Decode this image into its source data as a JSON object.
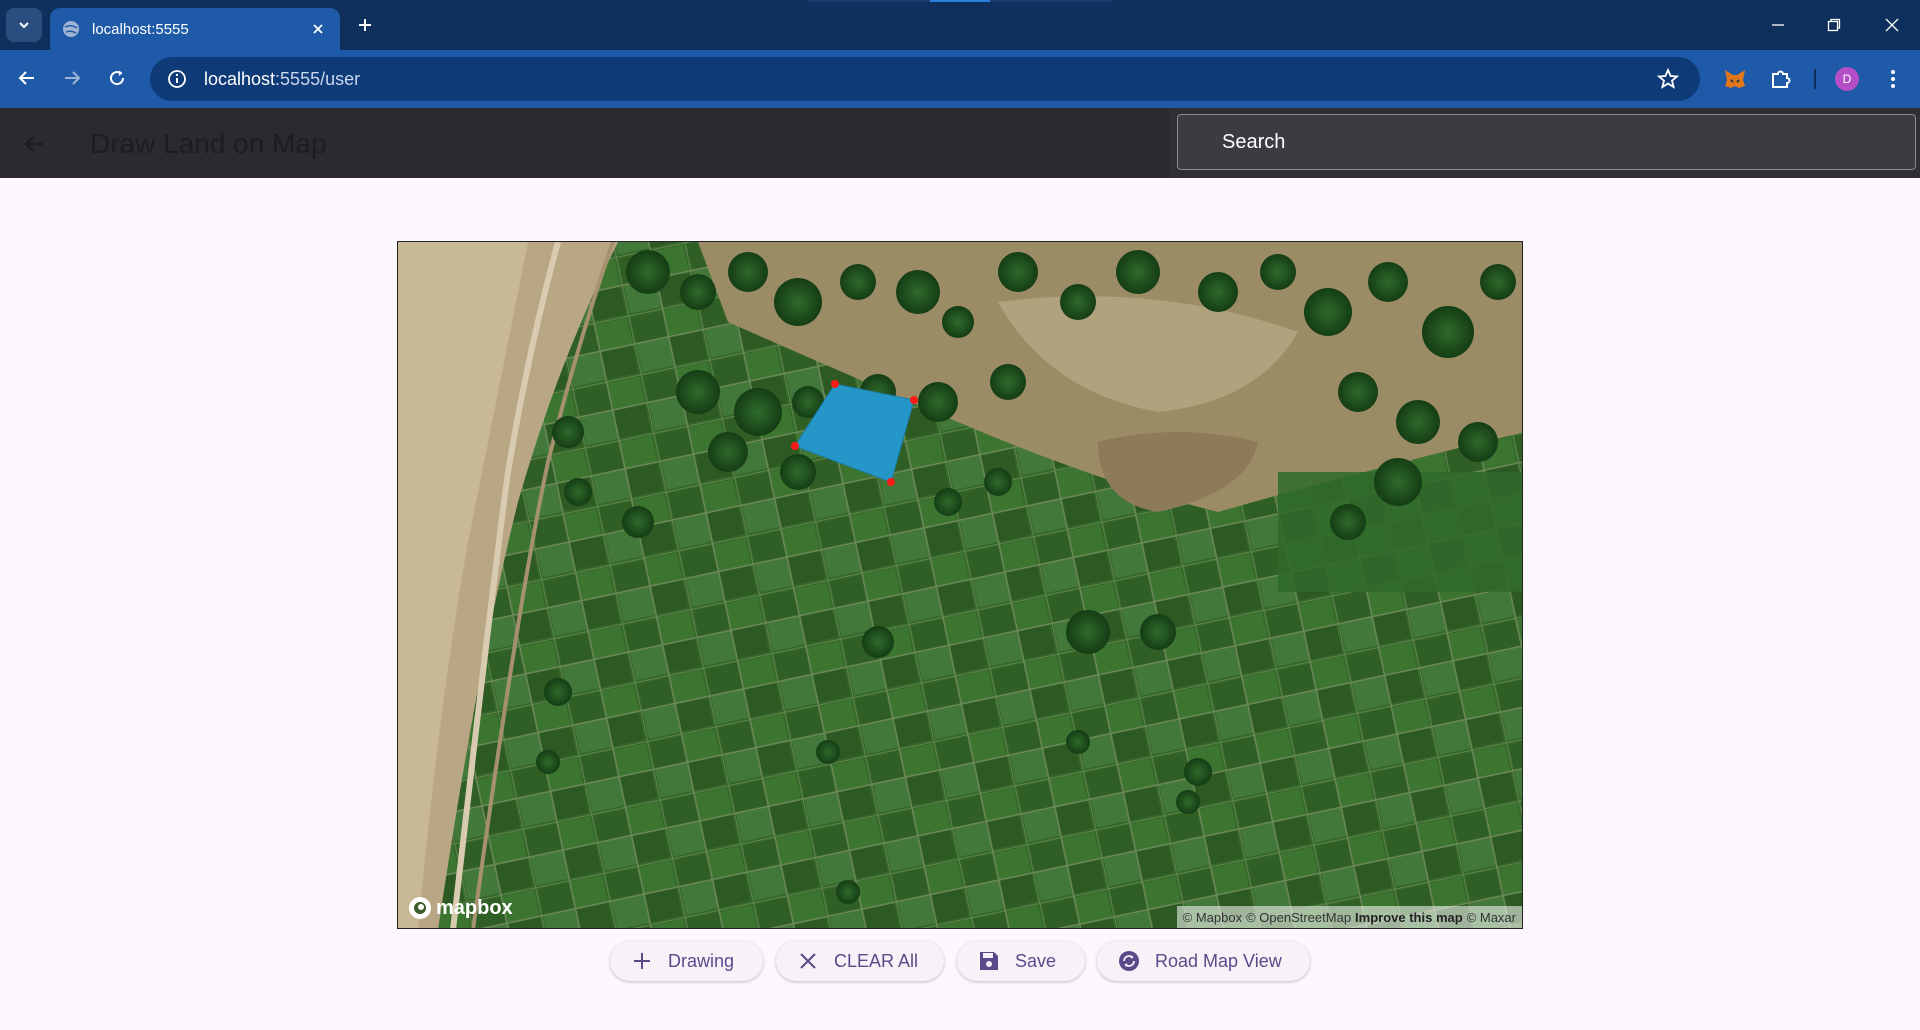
{
  "browser": {
    "tab_title": "localhost:5555",
    "url_host": "localhost",
    "url_rest": ":5555/user",
    "profile_initial": "D"
  },
  "appbar": {
    "title": "Draw Land on Map",
    "search_placeholder": "Search"
  },
  "map": {
    "logo_text": "mapbox",
    "attribution": {
      "mapbox": "© Mapbox",
      "osm": "© OpenStreetMap",
      "improve": "Improve this map",
      "maxar": "© Maxar"
    },
    "polygon_fill": "#2596c8",
    "vertex_color": "#ff1a1a"
  },
  "actions": {
    "drawing": "Drawing",
    "clear_all": "CLEAR All",
    "save": "Save",
    "road_map_view": "Road Map View"
  },
  "colors": {
    "tabstrip": "#0f2f5c",
    "toolbar": "#1e5aa8",
    "appbar": "#292b2f",
    "button_text": "#5a4a8a"
  }
}
